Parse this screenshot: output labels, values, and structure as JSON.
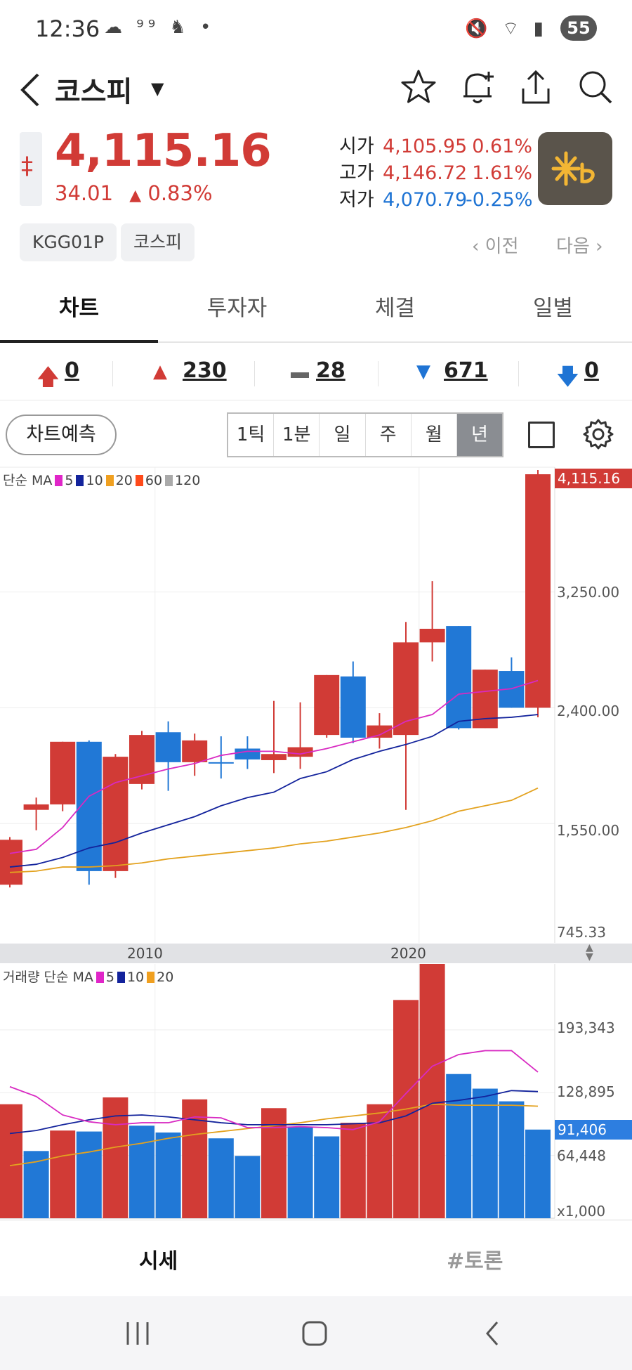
{
  "status": {
    "time": "12:36",
    "battery": "55"
  },
  "header": {
    "title": "코스피"
  },
  "price": {
    "current": "4,115.16",
    "change": "34.01",
    "change_pct": "0.83%",
    "ohl": [
      {
        "label": "시가",
        "value": "4,105.95",
        "pct": "0.61%",
        "tone": "red"
      },
      {
        "label": "고가",
        "value": "4,146.72",
        "pct": "1.61%",
        "tone": "red"
      },
      {
        "label": "저가",
        "value": "4,070.79",
        "pct": "-0.25%",
        "tone": "blue"
      }
    ]
  },
  "chips": [
    "KGG01P",
    "코스피"
  ],
  "nav": {
    "prev": "이전",
    "next": "다음"
  },
  "tabs": [
    "차트",
    "투자자",
    "체결",
    "일별"
  ],
  "adv_dec": {
    "upper_limit": "0",
    "up": "230",
    "flat": "28",
    "down": "671",
    "lower_limit": "0"
  },
  "toolbar": {
    "predict": "차트예측",
    "periods": [
      "1틱",
      "1분",
      "일",
      "주",
      "월",
      "년"
    ],
    "active_period": "년"
  },
  "chart_data": {
    "type": "candlestick",
    "price_legend": {
      "label": "단순 MA",
      "periods": [
        "5",
        "10",
        "20",
        "60",
        "120"
      ],
      "colors": [
        "#e026c8",
        "#13239c",
        "#f0a020",
        "#ff4a1a",
        "#aaaaaa"
      ]
    },
    "price_axis": {
      "ticks": [
        "3,250.00",
        "2,400.00",
        "1,550.00",
        "745.33"
      ],
      "ylim": [
        745.33,
        4115.16
      ],
      "current": "4,115.16"
    },
    "x_ticks": [
      "2010",
      "2020"
    ],
    "candles": [
      {
        "o": 1100,
        "h": 1450,
        "l": 1080,
        "c": 1430
      },
      {
        "o": 1650,
        "h": 1740,
        "l": 1500,
        "c": 1690
      },
      {
        "o": 1690,
        "h": 2090,
        "l": 1640,
        "c": 2150
      },
      {
        "o": 2150,
        "h": 2160,
        "l": 1100,
        "c": 1200
      },
      {
        "o": 1200,
        "h": 2060,
        "l": 1150,
        "c": 2040
      },
      {
        "o": 1840,
        "h": 2230,
        "l": 1800,
        "c": 2200
      },
      {
        "o": 2220,
        "h": 2300,
        "l": 1790,
        "c": 2000
      },
      {
        "o": 2000,
        "h": 2210,
        "l": 1900,
        "c": 2160
      },
      {
        "o": 2000,
        "h": 2190,
        "l": 1880,
        "c": 1990
      },
      {
        "o": 2100,
        "h": 2190,
        "l": 1950,
        "c": 2020
      },
      {
        "o": 2015,
        "h": 2450,
        "l": 1920,
        "c": 2060
      },
      {
        "o": 2040,
        "h": 2440,
        "l": 1950,
        "c": 2110
      },
      {
        "o": 2200,
        "h": 2550,
        "l": 2180,
        "c": 2640
      },
      {
        "o": 2630,
        "h": 2740,
        "l": 2140,
        "c": 2180
      },
      {
        "o": 2180,
        "h": 2360,
        "l": 2100,
        "c": 2270
      },
      {
        "o": 2200,
        "h": 3030,
        "l": 1650,
        "c": 2880
      },
      {
        "o": 2880,
        "h": 3330,
        "l": 2740,
        "c": 2980
      },
      {
        "o": 3000,
        "h": 3000,
        "l": 2240,
        "c": 2250
      },
      {
        "o": 2250,
        "h": 2650,
        "l": 2250,
        "c": 2680
      },
      {
        "o": 2670,
        "h": 2770,
        "l": 2400,
        "c": 2400
      },
      {
        "o": 2400,
        "h": 4146,
        "l": 2330,
        "c": 4115
      }
    ],
    "ma5": [
      1330,
      1360,
      1520,
      1750,
      1850,
      1900,
      1950,
      1990,
      2050,
      2080,
      2080,
      2060,
      2100,
      2150,
      2200,
      2300,
      2350,
      2500,
      2520,
      2540,
      2600
    ],
    "ma10": [
      1230,
      1250,
      1300,
      1370,
      1410,
      1480,
      1540,
      1600,
      1680,
      1740,
      1780,
      1880,
      1930,
      2020,
      2080,
      2130,
      2190,
      2300,
      2320,
      2330,
      2350
    ],
    "ma20": [
      1190,
      1200,
      1230,
      1230,
      1240,
      1260,
      1290,
      1310,
      1330,
      1350,
      1370,
      1400,
      1420,
      1450,
      1480,
      1520,
      1570,
      1640,
      1680,
      1720,
      1810
    ],
    "volume_legend": {
      "label": "거래량 단순 MA",
      "periods": [
        "5",
        "10",
        "20"
      ],
      "colors": [
        "#e026c8",
        "#13239c",
        "#f0a020"
      ]
    },
    "volume_axis": {
      "ticks": [
        "193,343",
        "128,895",
        "64,448",
        "x1,000"
      ],
      "current": "91,406"
    },
    "volume": [
      {
        "v": 117,
        "up": true
      },
      {
        "v": 69,
        "up": false
      },
      {
        "v": 90,
        "up": true
      },
      {
        "v": 89,
        "up": false
      },
      {
        "v": 124,
        "up": true
      },
      {
        "v": 95,
        "up": false
      },
      {
        "v": 88,
        "up": false
      },
      {
        "v": 122,
        "up": true
      },
      {
        "v": 82,
        "up": false
      },
      {
        "v": 64,
        "up": false
      },
      {
        "v": 113,
        "up": true
      },
      {
        "v": 94,
        "up": false
      },
      {
        "v": 84,
        "up": false
      },
      {
        "v": 98,
        "up": true
      },
      {
        "v": 117,
        "up": true
      },
      {
        "v": 224,
        "up": true
      },
      {
        "v": 261,
        "up": true
      },
      {
        "v": 148,
        "up": false
      },
      {
        "v": 133,
        "up": false
      },
      {
        "v": 120,
        "up": false
      },
      {
        "v": 91,
        "up": false
      }
    ],
    "vma5": [
      135,
      125,
      106,
      99,
      96,
      98,
      98,
      104,
      103,
      93,
      93,
      94,
      93,
      91,
      99,
      128,
      156,
      168,
      172,
      172,
      150
    ],
    "vma10": [
      87,
      90,
      96,
      101,
      105,
      106,
      104,
      101,
      98,
      96,
      96,
      96,
      96,
      97,
      98,
      105,
      118,
      121,
      125,
      131,
      130
    ],
    "vma20": [
      54,
      58,
      64,
      68,
      73,
      77,
      82,
      86,
      89,
      92,
      95,
      98,
      102,
      105,
      108,
      112,
      117,
      116,
      116,
      116,
      115
    ]
  },
  "bottom_tabs": [
    "시세",
    "#토론"
  ]
}
